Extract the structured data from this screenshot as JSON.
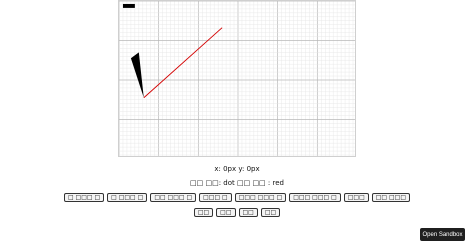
{
  "coords_text": "x: 0px y: 0px",
  "mode": {
    "prefix": "□□ □□: ",
    "tool": "dot",
    "middle": " □□ □□ : ",
    "color": "red"
  },
  "buttons_row1": [
    "□ □□□ □",
    "□ □□□ □",
    "□□ □□□ □",
    "□□□ □",
    "□□□ □□□ □",
    "□□□ □□□ □",
    "□□□",
    "□□ □□□"
  ],
  "buttons_row2": [
    "□□",
    "□□",
    "□□",
    "□□"
  ],
  "sandbox_label": "Open Sandbox",
  "colors": {
    "stroke": "#d40000",
    "fill": "#000000"
  }
}
